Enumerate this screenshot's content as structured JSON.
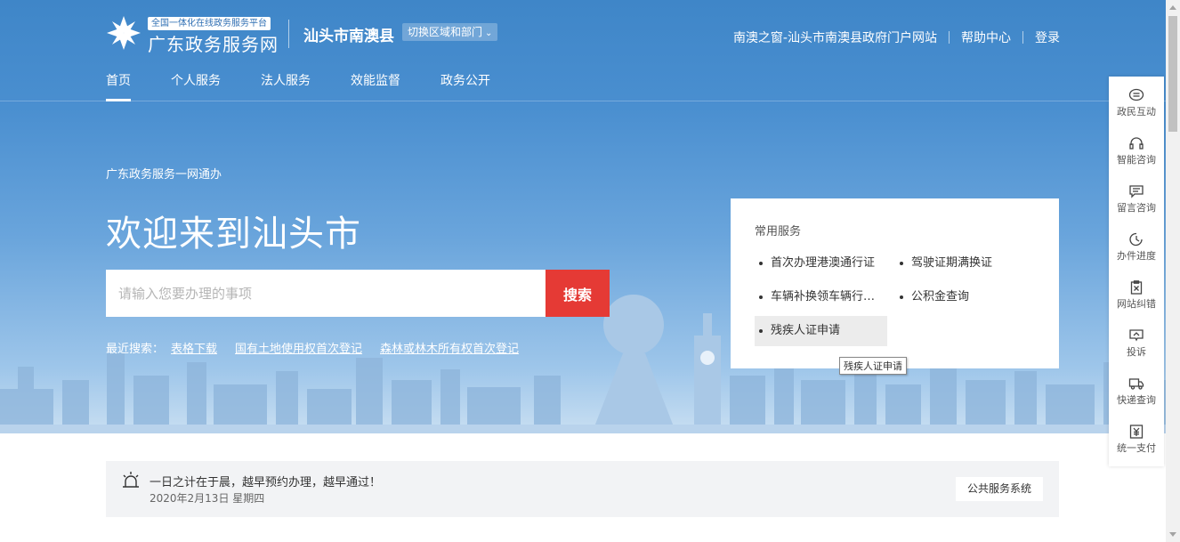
{
  "header": {
    "platform_badge": "全国一体化在线政务服务平台",
    "site_name": "广东政务服务网",
    "region": "汕头市南澳县",
    "switch_region": "切换区域和部门",
    "links": [
      "南澳之窗-汕头市南澳县政府门户网站",
      "帮助中心",
      "登录"
    ]
  },
  "nav": {
    "tabs": [
      {
        "label": "首页",
        "active": true
      },
      {
        "label": "个人服务"
      },
      {
        "label": "法人服务"
      },
      {
        "label": "效能监督"
      },
      {
        "label": "政务公开"
      }
    ]
  },
  "hero": {
    "tagline": "广东政务服务一网通办",
    "welcome": "欢迎来到汕头市",
    "search": {
      "placeholder": "请输入您要办理的事项",
      "button": "搜索"
    },
    "recent": {
      "label": "最近搜索：",
      "items": [
        "表格下载",
        "国有土地使用权首次登记",
        "森林或林木所有权首次登记"
      ]
    }
  },
  "common_services": {
    "title": "常用服务",
    "items": [
      "首次办理港澳通行证",
      "驾驶证期满换证",
      "车辆补换领车辆行…",
      "公积金查询",
      "残疾人证申请"
    ],
    "tooltip": "残疾人证申请"
  },
  "notice": {
    "message": "一日之计在于晨，越早预约办理，越早通过！",
    "date": "2020年2月13日 星期四",
    "button": "公共服务系统"
  },
  "sidebar": {
    "items": [
      {
        "label": "政民互动",
        "icon": "chat-bubble-icon"
      },
      {
        "label": "智能咨询",
        "icon": "headset-icon"
      },
      {
        "label": "留言咨询",
        "icon": "message-icon"
      },
      {
        "label": "办件进度",
        "icon": "clock-icon"
      },
      {
        "label": "网站纠错",
        "icon": "clipboard-x-icon"
      },
      {
        "label": "投诉",
        "icon": "complaint-icon"
      },
      {
        "label": "快递查询",
        "icon": "truck-icon"
      },
      {
        "label": "统一支付",
        "icon": "yuan-icon"
      }
    ]
  },
  "colors": {
    "accent_red": "#e53a35",
    "header_blue": "#3f86c8"
  }
}
